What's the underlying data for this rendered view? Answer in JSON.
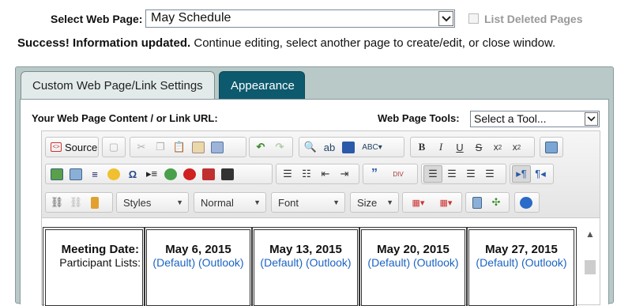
{
  "header": {
    "select_label": "Select Web Page:",
    "selected_page": "May Schedule",
    "list_deleted_label": "List Deleted Pages"
  },
  "message": {
    "bold": "Success! Information updated.",
    "rest": " Continue editing, select another page to create/edit, or close window."
  },
  "tabs": [
    {
      "label": "Custom Web Page/Link Settings",
      "active": false
    },
    {
      "label": "Appearance",
      "active": true
    }
  ],
  "content_label": "Your Web Page Content / or Link URL:",
  "tools": {
    "label": "Web Page Tools:",
    "selected": "Select a Tool..."
  },
  "editor": {
    "source_label": "Source",
    "combos": {
      "styles": "Styles",
      "format": "Normal",
      "font": "Font",
      "size": "Size"
    }
  },
  "table": {
    "row_label": "Meeting Date:",
    "participant_label": "Participant Lists:",
    "dates": [
      "May 6, 2015",
      "May 13, 2015",
      "May 20, 2015",
      "May 27, 2015"
    ],
    "link_default": "(Default)",
    "link_outlook": "(Outlook)"
  },
  "colors": {
    "tab_active": "#0d5a6e",
    "panel": "#b9c9c8",
    "link": "#1a63c2"
  }
}
